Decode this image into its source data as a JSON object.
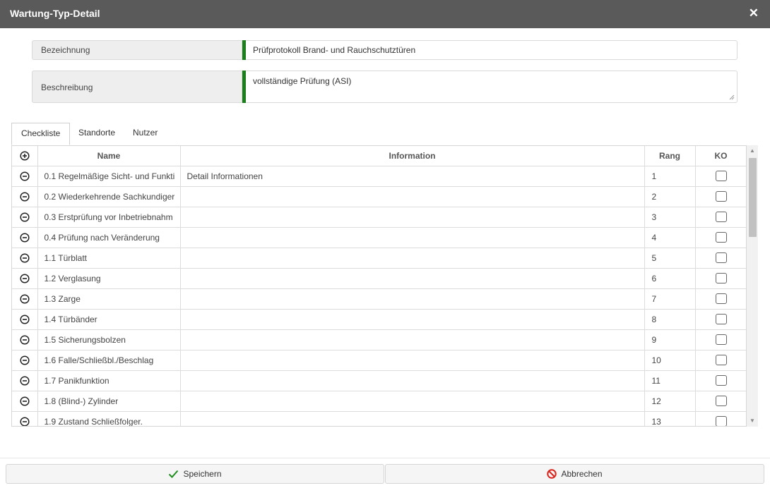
{
  "window": {
    "title": "Wartung-Typ-Detail",
    "close_icon": "close-icon"
  },
  "fields": {
    "bezeichnung": {
      "label": "Bezeichnung",
      "value": "Prüfprotokoll Brand- und Rauchschutztüren"
    },
    "beschreibung": {
      "label": "Beschreibung",
      "value": "vollständige Prüfung (ASI)"
    }
  },
  "colors": {
    "accent_bar": "#1a7f1a",
    "save_icon": "#1e8c1e",
    "cancel_icon": "#d9231c",
    "titlebar": "#5a5a5a"
  },
  "tabs": [
    {
      "label": "Checkliste",
      "active": true
    },
    {
      "label": "Standorte",
      "active": false
    },
    {
      "label": "Nutzer",
      "active": false
    }
  ],
  "table": {
    "add_icon": "plus-circle-icon",
    "remove_icon": "minus-circle-icon",
    "columns": {
      "name": "Name",
      "information": "Information",
      "rang": "Rang",
      "ko": "KO"
    },
    "rows": [
      {
        "name": "0.1 Regelmäßige Sicht- und Funkti",
        "information": "Detail Informationen",
        "rang": "1",
        "ko": false
      },
      {
        "name": "0.2 Wiederkehrende Sachkundiger",
        "information": "",
        "rang": "2",
        "ko": false
      },
      {
        "name": "0.3 Erstprüfung vor Inbetriebnahm",
        "information": "",
        "rang": "3",
        "ko": false
      },
      {
        "name": "0.4 Prüfung nach Veränderung",
        "information": "",
        "rang": "4",
        "ko": false
      },
      {
        "name": "1.1 Türblatt",
        "information": "",
        "rang": "5",
        "ko": false
      },
      {
        "name": "1.2 Verglasung",
        "information": "",
        "rang": "6",
        "ko": false
      },
      {
        "name": "1.3 Zarge",
        "information": "",
        "rang": "7",
        "ko": false
      },
      {
        "name": "1.4 Türbänder",
        "information": "",
        "rang": "8",
        "ko": false
      },
      {
        "name": "1.5 Sicherungsbolzen",
        "information": "",
        "rang": "9",
        "ko": false
      },
      {
        "name": "1.6 Falle/Schließbl./Beschlag",
        "information": "",
        "rang": "10",
        "ko": false
      },
      {
        "name": "1.7 Panikfunktion",
        "information": "",
        "rang": "11",
        "ko": false
      },
      {
        "name": "1.8 (Blind-) Zylinder",
        "information": "",
        "rang": "12",
        "ko": false
      },
      {
        "name": "1.9 Zustand Schließfolger.",
        "information": "",
        "rang": "13",
        "ko": false
      }
    ]
  },
  "footer": {
    "save_label": "Speichern",
    "save_icon": "checkmark-icon",
    "cancel_label": "Abbrechen",
    "cancel_icon": "prohibited-icon"
  }
}
